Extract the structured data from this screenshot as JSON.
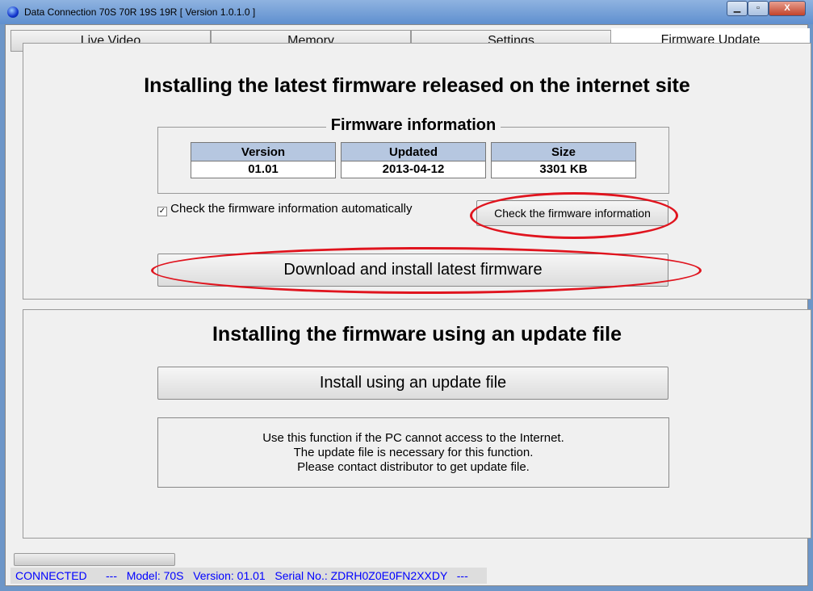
{
  "window": {
    "title": "Data Connection 70S 70R 19S 19R   [ Version 1.0.1.0 ]",
    "minimize": "▁",
    "maximize": "▫",
    "close": "X"
  },
  "tabs": [
    {
      "label": "Live Video"
    },
    {
      "label": "Memory"
    },
    {
      "label": "Settings"
    },
    {
      "label": "Firmware Update",
      "active": true
    }
  ],
  "online": {
    "heading": "Installing the latest firmware released on the internet site",
    "group_title": "Firmware information",
    "columns": [
      "Version",
      "Updated",
      "Size"
    ],
    "values": [
      "01.01",
      "2013-04-12",
      "3301 KB"
    ],
    "auto_check_label": "Check the firmware information automatically",
    "auto_check": true,
    "check_button": "Check the firmware information",
    "download_button": "Download and install latest firmware"
  },
  "offline": {
    "heading": "Installing the firmware using an update file",
    "install_button": "Install using an update file",
    "note": [
      "Use this function if the PC cannot access to the Internet.",
      "The update file is necessary for this function.",
      "Please contact distributor to get update file."
    ]
  },
  "status": {
    "connection": "CONNECTED",
    "sep": "---",
    "model": "Model: 70S",
    "version": "Version: 01.01",
    "serial": "Serial No.: ZDRH0Z0E0FN2XXDY",
    "end": "---"
  },
  "colors": {
    "highlight_ring": "#e0141e",
    "status_text": "#0000ff",
    "table_header": "#b6c7e0"
  }
}
